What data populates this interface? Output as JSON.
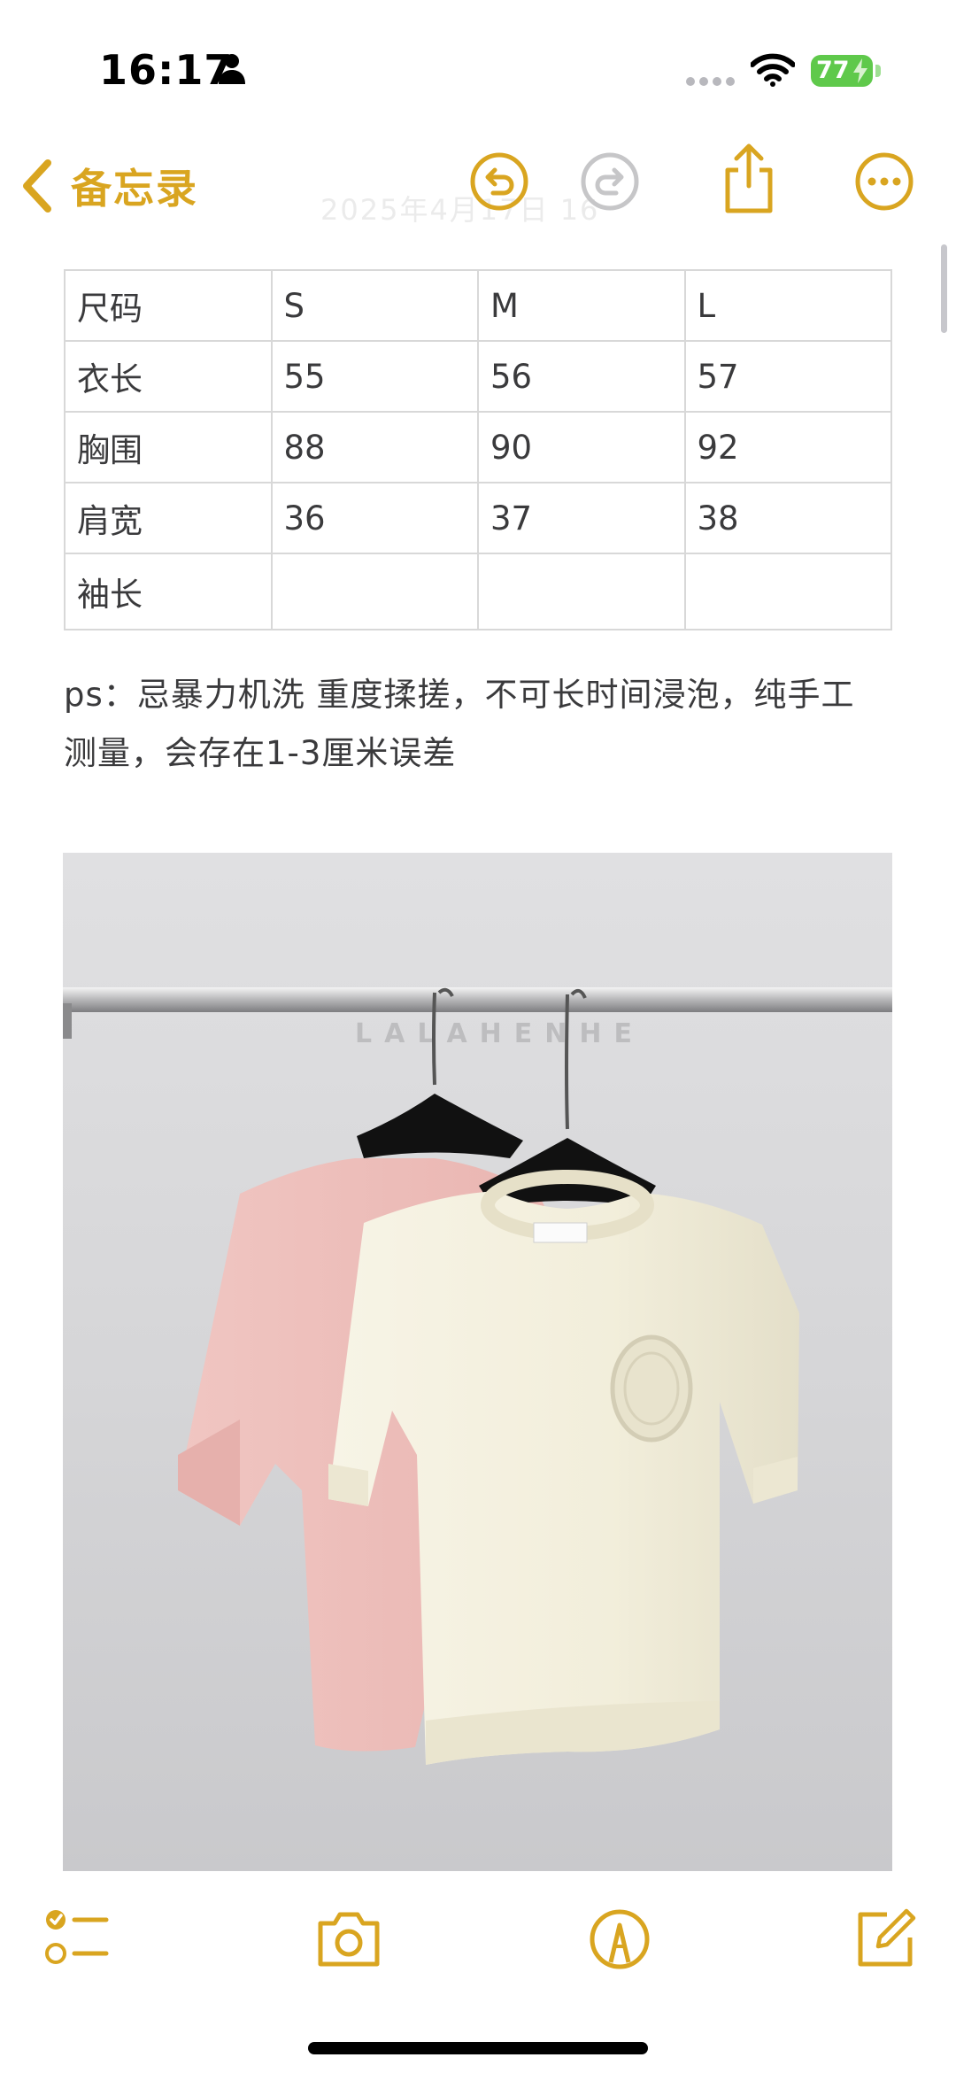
{
  "status_bar": {
    "time": "16:17",
    "battery_level": "77",
    "icons": [
      "person-icon",
      "cellular-dots-icon",
      "wifi-icon",
      "battery-charging-icon"
    ]
  },
  "nav": {
    "back_label": "备忘录",
    "icons": [
      "chevron-left-icon",
      "undo-icon",
      "redo-icon",
      "share-icon",
      "more-icon"
    ],
    "accent_color": "#d9a520"
  },
  "size_table": {
    "rows": [
      [
        "尺码",
        "S",
        "M",
        "L"
      ],
      [
        "衣长",
        "55",
        "56",
        "57"
      ],
      [
        "胸围",
        "88",
        "90",
        "92"
      ],
      [
        "肩宽",
        "36",
        "37",
        "38"
      ],
      [
        "袖长",
        "",
        "",
        ""
      ]
    ]
  },
  "note": {
    "line1": "ps：忌暴力机洗 重度揉搓，不可长时间浸泡，纯手工",
    "line2": "测量，会存在1-3厘米误差"
  },
  "photo": {
    "watermark": "LALAHENHE"
  },
  "toolbar": {
    "icons": [
      "checklist-icon",
      "camera-icon",
      "markup-icon",
      "compose-icon"
    ]
  }
}
